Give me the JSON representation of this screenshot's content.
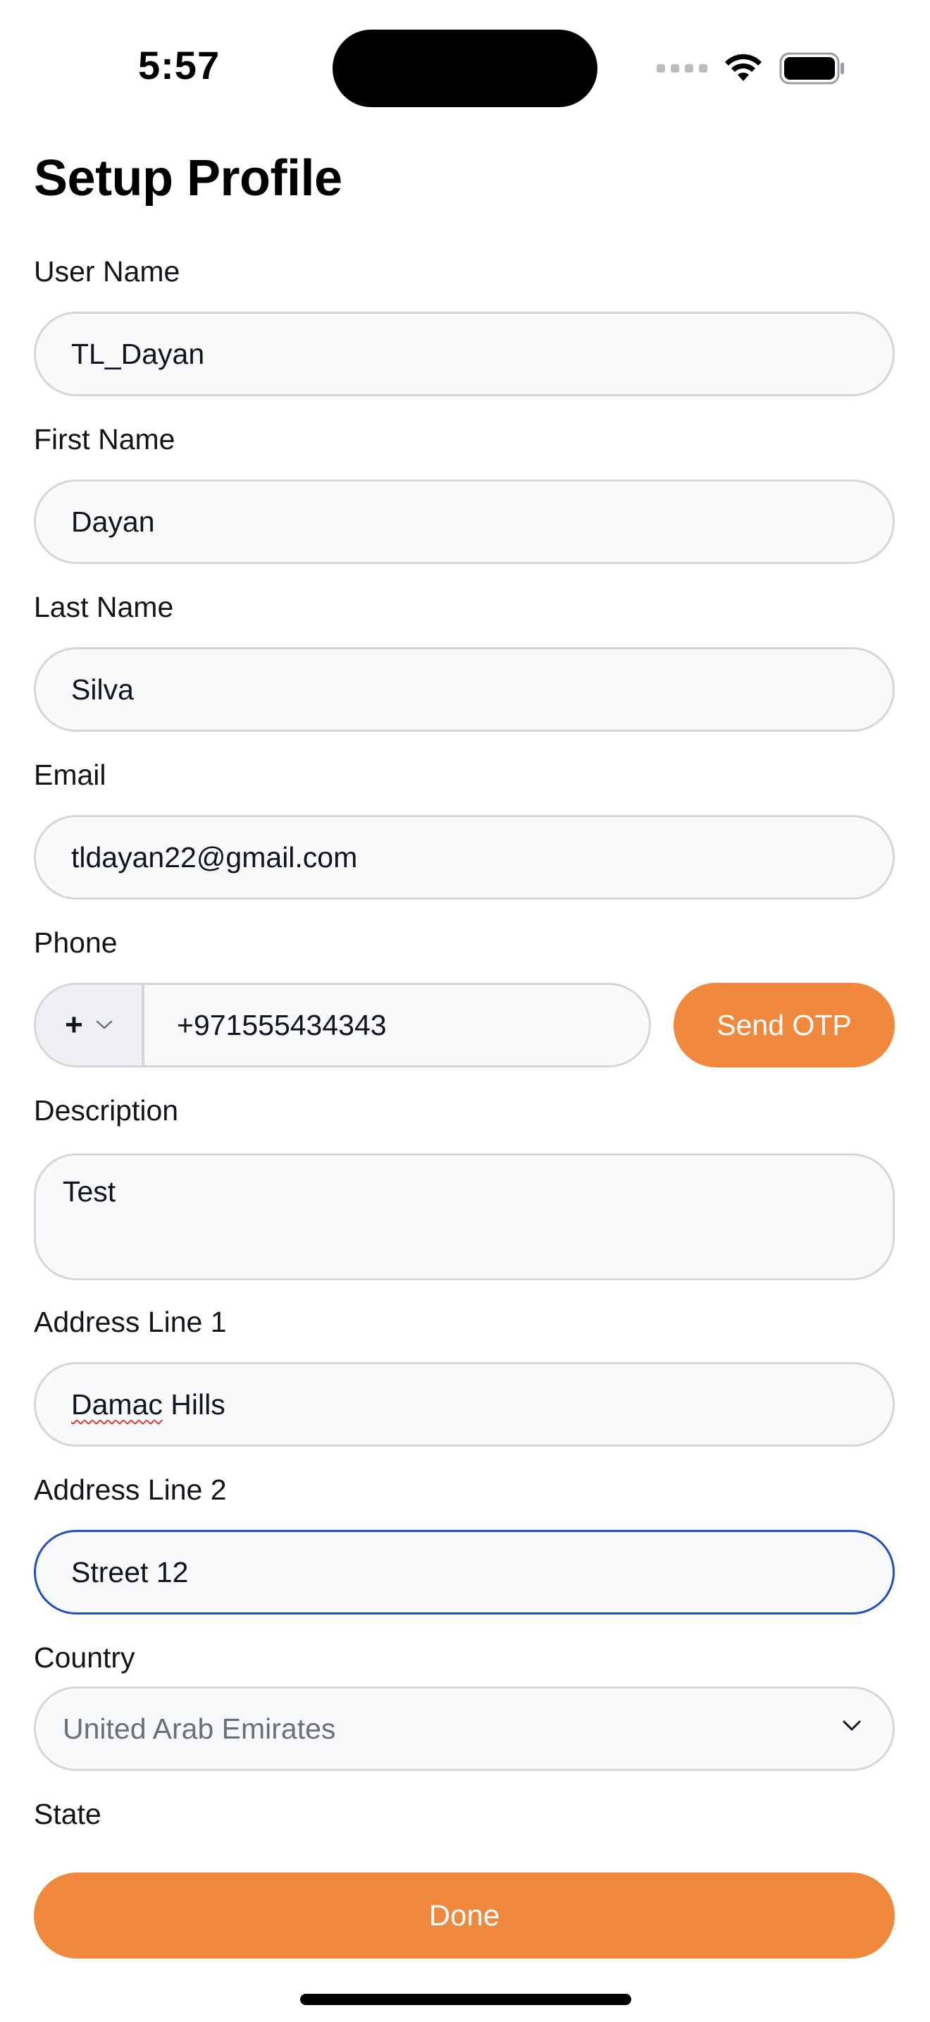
{
  "status_bar": {
    "time": "5:57"
  },
  "page": {
    "title": "Setup Profile"
  },
  "form": {
    "user_name": {
      "label": "User Name",
      "value": "TL_Dayan"
    },
    "first_name": {
      "label": "First Name",
      "value": "Dayan"
    },
    "last_name": {
      "label": "Last Name",
      "value": "Silva"
    },
    "email": {
      "label": "Email",
      "value": "tldayan22@gmail.com"
    },
    "phone": {
      "label": "Phone",
      "country_code": "+",
      "value": "+971555434343",
      "send_otp_label": "Send OTP"
    },
    "description": {
      "label": "Description",
      "value": "Test"
    },
    "address_line_1": {
      "label": "Address Line 1",
      "value_word_1": "Damac",
      "value_word_2": " Hills"
    },
    "address_line_2": {
      "label": "Address Line 2",
      "value": "Street 12"
    },
    "country": {
      "label": "Country",
      "selected": "United Arab Emirates"
    },
    "state": {
      "label": "State"
    }
  },
  "footer": {
    "done_label": "Done"
  },
  "colors": {
    "accent": "#f0883e",
    "focus_border": "#1f4fc1",
    "field_border": "#d4d6da",
    "field_bg": "#f8f9fb"
  },
  "icons": {
    "cellular": "cellular-signal-icon",
    "wifi": "wifi-icon",
    "battery": "battery-icon",
    "chevron": "chevron-down-icon"
  }
}
